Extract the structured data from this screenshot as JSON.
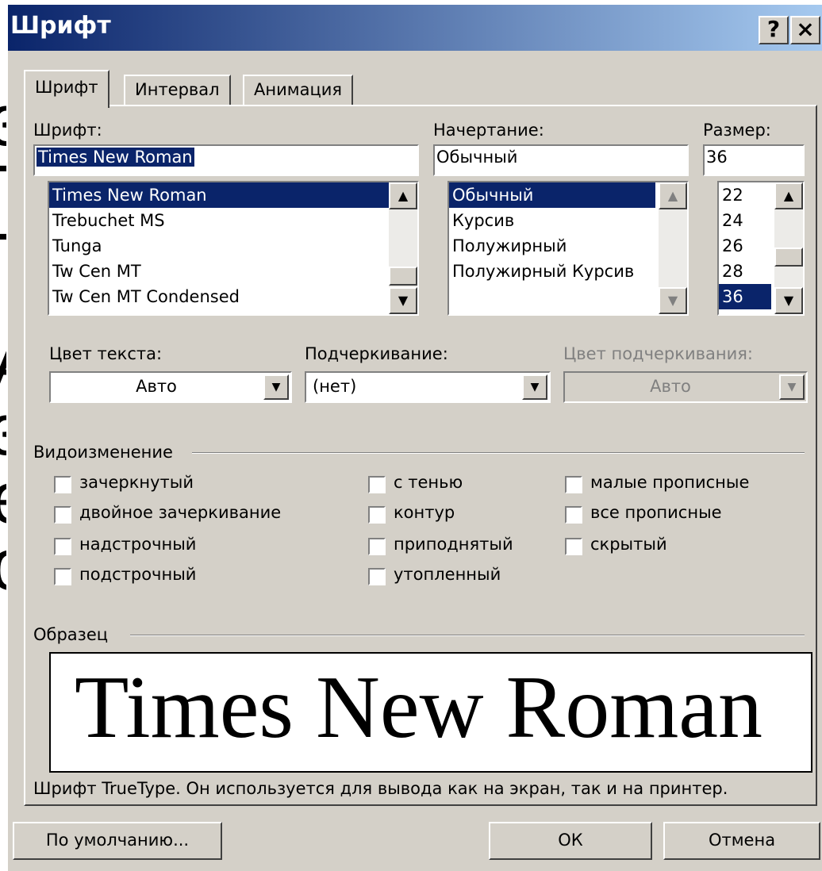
{
  "background": {
    "chars": [
      "з",
      "-",
      "-",
      "А",
      "з",
      "е",
      "о"
    ]
  },
  "window": {
    "title": "Шрифт",
    "help_label": "?",
    "close_label": "×"
  },
  "tabs": [
    {
      "label": "Шрифт",
      "active": true
    },
    {
      "label": "Интервал",
      "active": false
    },
    {
      "label": "Анимация",
      "active": false
    }
  ],
  "font": {
    "label": "Шрифт:",
    "value": "Times New Roman",
    "list": [
      "Times New Roman",
      "Trebuchet MS",
      "Tunga",
      "Tw Cen MT",
      "Tw Cen MT Condensed"
    ],
    "selected": "Times New Roman"
  },
  "style": {
    "label": "Начертание:",
    "value": "Обычный",
    "list": [
      "Обычный",
      "Курсив",
      "Полужирный",
      "Полужирный Курсив"
    ],
    "selected": "Обычный"
  },
  "size": {
    "label": "Размер:",
    "value": "36",
    "list": [
      "22",
      "24",
      "26",
      "28",
      "36"
    ],
    "selected": "36"
  },
  "color": {
    "label": "Цвет текста:",
    "value": "Авто"
  },
  "underline": {
    "label": "Подчеркивание:",
    "value": "(нет)"
  },
  "underline_color": {
    "label": "Цвет подчеркивания:",
    "value": "Авто",
    "enabled": false
  },
  "effects": {
    "title": "Видоизменение",
    "items": [
      {
        "label": "зачеркнутый",
        "checked": false
      },
      {
        "label": "двойное зачеркивание",
        "checked": false
      },
      {
        "label": "надстрочный",
        "checked": false
      },
      {
        "label": "подстрочный",
        "checked": false
      },
      {
        "label": "с тенью",
        "checked": false
      },
      {
        "label": "контур",
        "checked": false
      },
      {
        "label": "приподнятый",
        "checked": false
      },
      {
        "label": "утопленный",
        "checked": false
      },
      {
        "label": "малые прописные",
        "checked": false
      },
      {
        "label": "все прописные",
        "checked": false
      },
      {
        "label": "скрытый",
        "checked": false
      }
    ]
  },
  "sample": {
    "title": "Образец",
    "text": "Times New Roman",
    "note": "Шрифт TrueType. Он используется для вывода как на экран, так и на принтер."
  },
  "buttons": {
    "default": "По умолчанию...",
    "ok": "ОК",
    "cancel": "Отмена"
  }
}
